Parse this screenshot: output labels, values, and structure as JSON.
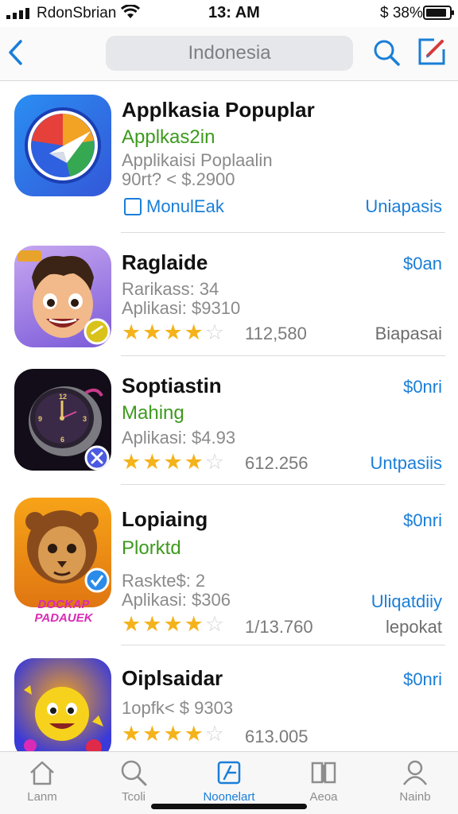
{
  "status_bar": {
    "carrier": "RdonSbrian",
    "time": "13: AM",
    "battery_text": "$ 38%",
    "battery_level": 0.9
  },
  "navbar": {
    "search_text": "Indonesia",
    "icons": [
      "back-chevron-icon",
      "search-icon",
      "compose-icon"
    ]
  },
  "apps": [
    {
      "title": "Applkasia Popuplar",
      "green": "Applkas2in",
      "sub1": "Applikaisi Poplaalin",
      "sub2": "90rt? < $.2900",
      "checkbox_label": "MonulEak",
      "action": "Uniapasis"
    },
    {
      "title": "Raglaide",
      "price": "$0an",
      "sub1": "Rarikass: 34",
      "sub2": "Aplikasi: $9310",
      "stars": 4,
      "rating_count": "112,580",
      "action": "Biapasai"
    },
    {
      "title": "Soptiastin",
      "price": "$0nri",
      "green": "Mahing",
      "sub1": "Aplikasi: $4.93",
      "stars": 4,
      "rating_count": "612.256",
      "action": "Untpasiis"
    },
    {
      "title": "Lopiaing",
      "price": "$0nri",
      "green": "Plorktd",
      "sub1": "Raskte$: 2",
      "sub2": "Aplikasi: $306",
      "stars": 4,
      "rating_count": "1/13.760",
      "action": "Uliqatdiiy",
      "action2": "lepokat",
      "icon_banner": "DOCKAP PADAUEK"
    },
    {
      "title": "Oiplsaidar",
      "price": "$0nri",
      "sub1": "1opfk< $ 9303",
      "stars": 4,
      "rating_count": "613.005"
    }
  ],
  "tabs": [
    {
      "label": "Lanm",
      "icon": "home-icon",
      "active": false
    },
    {
      "label": "Tcoli",
      "icon": "search-icon",
      "active": false
    },
    {
      "label": "Noonelart",
      "icon": "updates-icon",
      "active": true
    },
    {
      "label": "Aeoa",
      "icon": "book-icon",
      "active": false
    },
    {
      "label": "Nainb",
      "icon": "profile-icon",
      "active": false
    }
  ],
  "colors": {
    "accent": "#1a7ed8",
    "green": "#3d9a1e",
    "star": "#f4b21b"
  }
}
